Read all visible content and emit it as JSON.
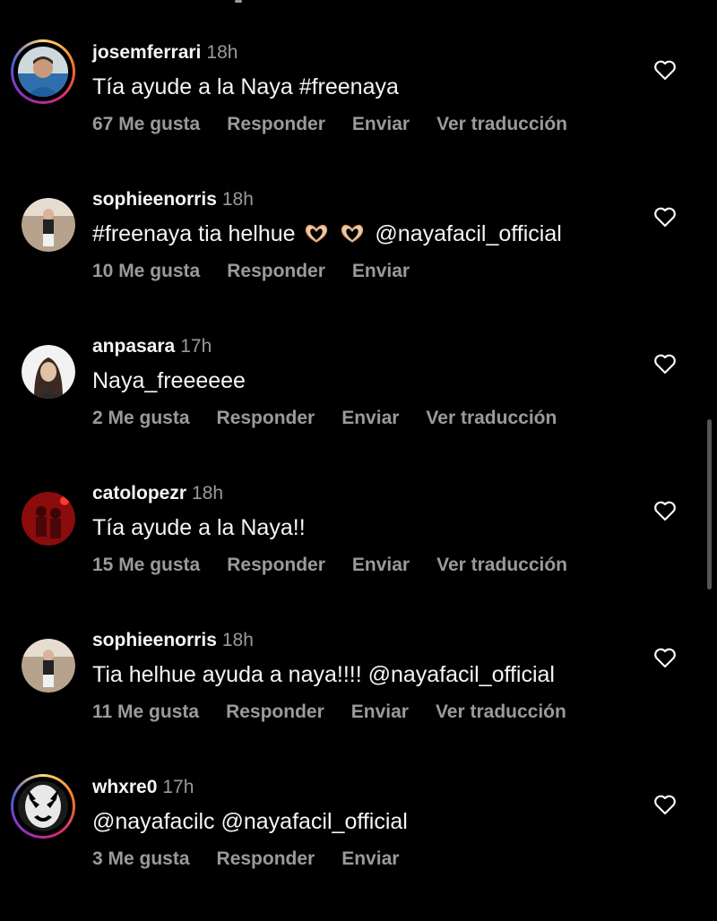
{
  "comments": [
    {
      "username": "josemferrari",
      "time": "18h",
      "text": "Tía ayude a la Naya #freenaya",
      "likes": "67 Me gusta",
      "reply": "Responder",
      "send": "Enviar",
      "translate": "Ver traducción"
    },
    {
      "username": "sophieenorris",
      "time": "18h",
      "text_before": "#freenaya tia helhue",
      "text_after": "@nayafacil_official",
      "likes": "10 Me gusta",
      "reply": "Responder",
      "send": "Enviar"
    },
    {
      "username": "anpasara",
      "time": "17h",
      "text": "Naya_freeeeee",
      "likes": "2 Me gusta",
      "reply": "Responder",
      "send": "Enviar",
      "translate": "Ver traducción"
    },
    {
      "username": "catolopezr",
      "time": "18h",
      "text": "Tía ayude a la Naya!!",
      "likes": "15 Me gusta",
      "reply": "Responder",
      "send": "Enviar",
      "translate": "Ver traducción"
    },
    {
      "username": "sophieenorris",
      "time": "18h",
      "text": "Tia helhue ayuda a naya!!!! @nayafacil_official",
      "likes": "11 Me gusta",
      "reply": "Responder",
      "send": "Enviar",
      "translate": "Ver traducción"
    },
    {
      "username": "whxre0",
      "time": "17h",
      "text": "@nayafacilc @nayafacil_official",
      "likes": "3 Me gusta",
      "reply": "Responder",
      "send": "Enviar"
    }
  ],
  "icons": {
    "like": "heart-icon",
    "emoji": "heart-hands-emoji"
  },
  "colors": {
    "background": "#000000",
    "text": "#f5f5f5",
    "muted": "#9a9a9a"
  }
}
